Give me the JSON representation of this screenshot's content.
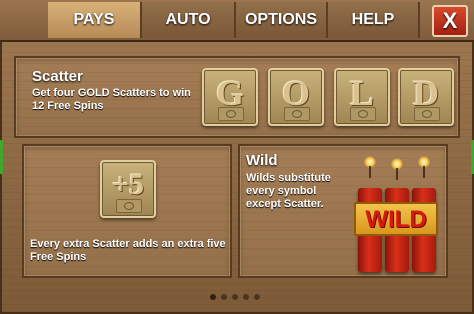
{
  "tabs": [
    {
      "label": "PAYS",
      "active": true
    },
    {
      "label": "AUTO",
      "active": false
    },
    {
      "label": "OPTIONS",
      "active": false
    },
    {
      "label": "HELP",
      "active": false
    }
  ],
  "close_label": "X",
  "scatter": {
    "title": "Scatter",
    "description": "Get four GOLD Scatters to win 12 Free Spins",
    "tiles": [
      "G",
      "O",
      "L",
      "D"
    ]
  },
  "extra_scatter": {
    "badge": "+5",
    "description": "Every extra Scatter adds an extra five Free Spins"
  },
  "wild": {
    "title": "Wild",
    "description": "Wilds substitute every symbol except Scatter.",
    "symbol_text": "WILD"
  },
  "pagination": {
    "total": 5,
    "current": 1
  },
  "colors": {
    "wood": "#94704a",
    "tab_active": "#d8b27a",
    "close_button": "#c43420",
    "dynamite": "#d8301a",
    "wild_band": "#f3c44a"
  },
  "icons": [
    "close-icon",
    "gold-tile-icon",
    "plus-five-icon",
    "dynamite-wild-icon"
  ]
}
